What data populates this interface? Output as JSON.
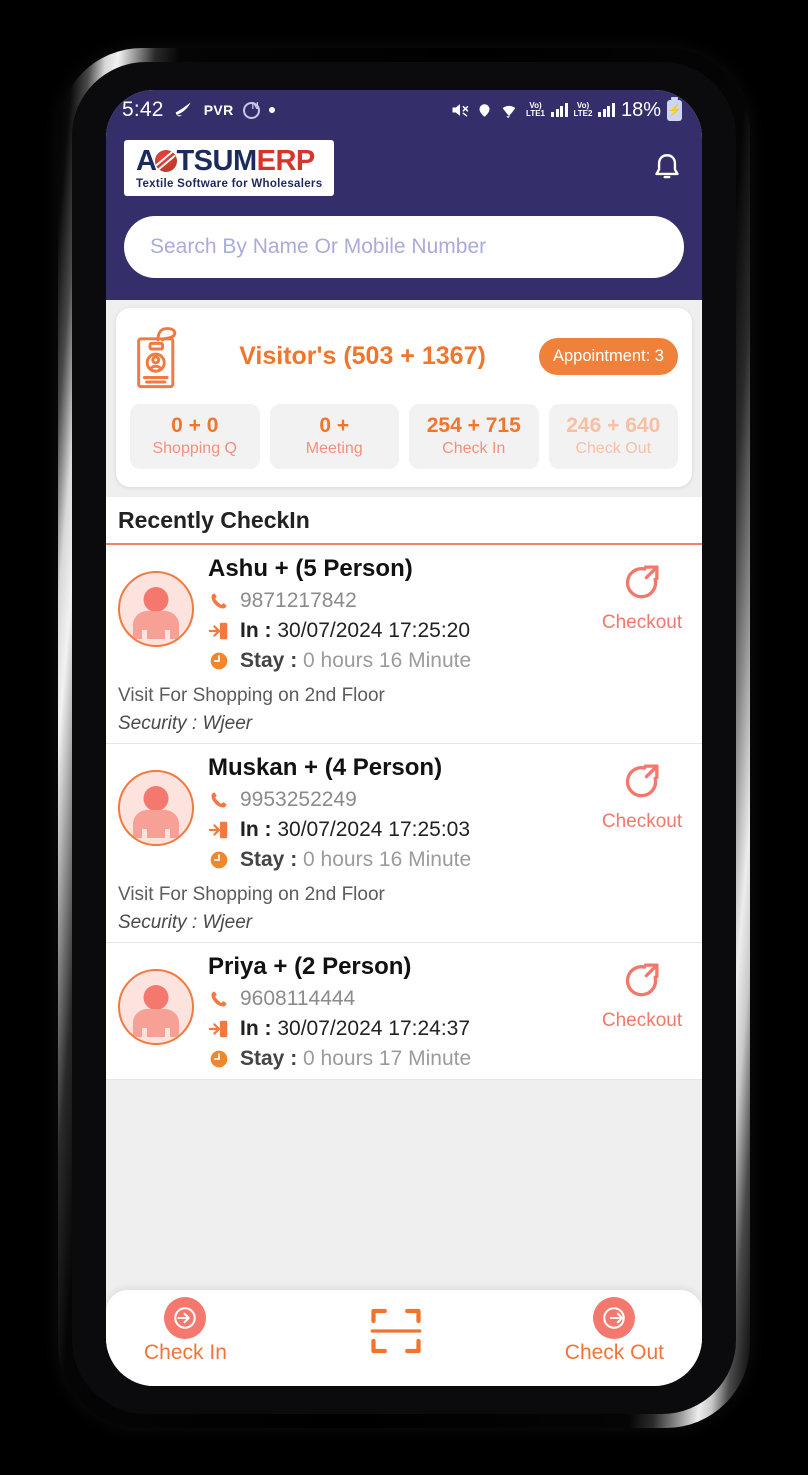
{
  "statusbar": {
    "time": "5:42",
    "carrier": "PVR",
    "nfc_icon": "nfc-icon",
    "dot_icon": "dot-indicator-icon",
    "mute_icon": "mute-icon",
    "location_icon": "location-pin-icon",
    "wifi_icon": "wifi-icon",
    "sim1_label": "LTE1",
    "sim2_label": "LTE2",
    "volte_label": "Vo)",
    "battery_percent": "18%",
    "battery_icon": "charging-battery-icon"
  },
  "header": {
    "logo": {
      "part_a": "A",
      "orb_icon": "logo-orb-icon",
      "part_tsum": "TSUM",
      "part_erp": "ERP",
      "tagline": "Textile Software for Wholesalers"
    },
    "bell_icon": "notification-bell-icon",
    "search": {
      "placeholder": "Search By Name Or Mobile Number",
      "value": ""
    }
  },
  "visitor_card": {
    "badge_icon": "visitor-badge-icon",
    "title": "Visitor's (503 + 1367)",
    "appointment_label": "Appointment: 3",
    "stats": [
      {
        "value": "0 + 0",
        "label": "Shopping Q",
        "muted": false
      },
      {
        "value": "0 +",
        "label": "Meeting",
        "muted": false
      },
      {
        "value": "254 + 715",
        "label": "Check In",
        "muted": false
      },
      {
        "value": "246 + 640",
        "label": "Check Out",
        "muted": true
      }
    ]
  },
  "recent_section": {
    "title": "Recently CheckIn",
    "items": [
      {
        "name": "Ashu + (5 Person)",
        "phone": "9871217842",
        "in_label": "In :",
        "in_value": "30/07/2024 17:25:20",
        "stay_label": "Stay :",
        "stay_value": "0 hours 16 Minute",
        "note": "Visit For Shopping on 2nd Floor",
        "security": "Security : Wjeer",
        "checkout_label": "Checkout"
      },
      {
        "name": "Muskan  + (4 Person)",
        "phone": "9953252249",
        "in_label": "In :",
        "in_value": "30/07/2024 17:25:03",
        "stay_label": "Stay :",
        "stay_value": "0 hours 16 Minute",
        "note": "Visit For Shopping on 2nd Floor",
        "security": "Security : Wjeer",
        "checkout_label": "Checkout"
      },
      {
        "name": "Priya  + (2 Person)",
        "phone": "9608114444",
        "in_label": "In :",
        "in_value": "30/07/2024 17:24:37",
        "stay_label": "Stay :",
        "stay_value": "0 hours 17 Minute",
        "note": "",
        "security": "",
        "checkout_label": "Checkout"
      }
    ]
  },
  "bottom_nav": {
    "check_in_label": "Check In",
    "check_in_icon": "check-in-arrow-icon",
    "scan_icon": "qr-scan-icon",
    "check_out_label": "Check Out",
    "check_out_icon": "check-out-arrow-icon"
  },
  "colors": {
    "header_bg": "#342f6b",
    "accent_orange": "#f0762b",
    "accent_salmon": "#f4786d",
    "muted_orange": "#f8bfa4"
  }
}
